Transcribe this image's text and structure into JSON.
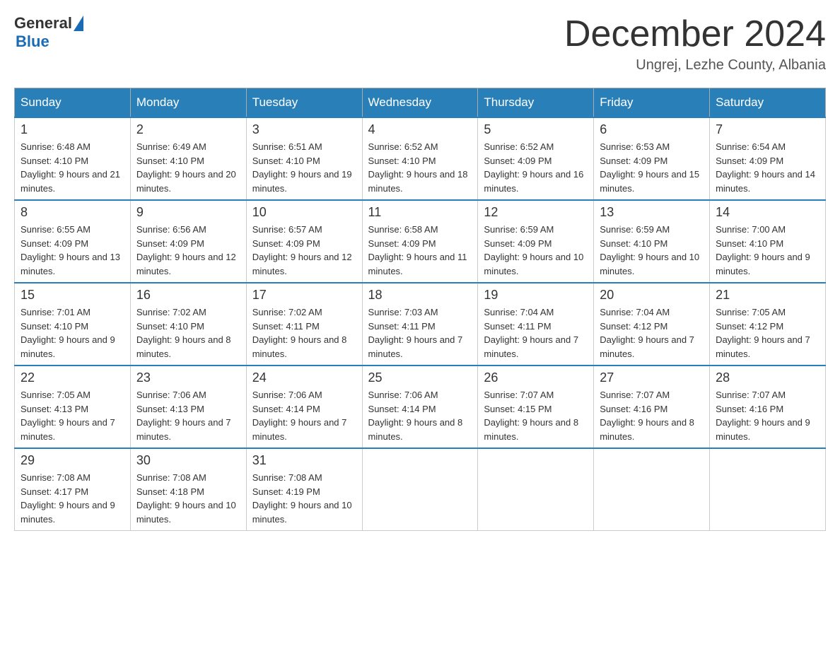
{
  "header": {
    "logo_general": "General",
    "logo_blue": "Blue",
    "month_title": "December 2024",
    "location": "Ungrej, Lezhe County, Albania"
  },
  "days_of_week": [
    "Sunday",
    "Monday",
    "Tuesday",
    "Wednesday",
    "Thursday",
    "Friday",
    "Saturday"
  ],
  "weeks": [
    [
      {
        "day": "1",
        "sunrise": "6:48 AM",
        "sunset": "4:10 PM",
        "daylight": "9 hours and 21 minutes."
      },
      {
        "day": "2",
        "sunrise": "6:49 AM",
        "sunset": "4:10 PM",
        "daylight": "9 hours and 20 minutes."
      },
      {
        "day": "3",
        "sunrise": "6:51 AM",
        "sunset": "4:10 PM",
        "daylight": "9 hours and 19 minutes."
      },
      {
        "day": "4",
        "sunrise": "6:52 AM",
        "sunset": "4:10 PM",
        "daylight": "9 hours and 18 minutes."
      },
      {
        "day": "5",
        "sunrise": "6:52 AM",
        "sunset": "4:09 PM",
        "daylight": "9 hours and 16 minutes."
      },
      {
        "day": "6",
        "sunrise": "6:53 AM",
        "sunset": "4:09 PM",
        "daylight": "9 hours and 15 minutes."
      },
      {
        "day": "7",
        "sunrise": "6:54 AM",
        "sunset": "4:09 PM",
        "daylight": "9 hours and 14 minutes."
      }
    ],
    [
      {
        "day": "8",
        "sunrise": "6:55 AM",
        "sunset": "4:09 PM",
        "daylight": "9 hours and 13 minutes."
      },
      {
        "day": "9",
        "sunrise": "6:56 AM",
        "sunset": "4:09 PM",
        "daylight": "9 hours and 12 minutes."
      },
      {
        "day": "10",
        "sunrise": "6:57 AM",
        "sunset": "4:09 PM",
        "daylight": "9 hours and 12 minutes."
      },
      {
        "day": "11",
        "sunrise": "6:58 AM",
        "sunset": "4:09 PM",
        "daylight": "9 hours and 11 minutes."
      },
      {
        "day": "12",
        "sunrise": "6:59 AM",
        "sunset": "4:09 PM",
        "daylight": "9 hours and 10 minutes."
      },
      {
        "day": "13",
        "sunrise": "6:59 AM",
        "sunset": "4:10 PM",
        "daylight": "9 hours and 10 minutes."
      },
      {
        "day": "14",
        "sunrise": "7:00 AM",
        "sunset": "4:10 PM",
        "daylight": "9 hours and 9 minutes."
      }
    ],
    [
      {
        "day": "15",
        "sunrise": "7:01 AM",
        "sunset": "4:10 PM",
        "daylight": "9 hours and 9 minutes."
      },
      {
        "day": "16",
        "sunrise": "7:02 AM",
        "sunset": "4:10 PM",
        "daylight": "9 hours and 8 minutes."
      },
      {
        "day": "17",
        "sunrise": "7:02 AM",
        "sunset": "4:11 PM",
        "daylight": "9 hours and 8 minutes."
      },
      {
        "day": "18",
        "sunrise": "7:03 AM",
        "sunset": "4:11 PM",
        "daylight": "9 hours and 7 minutes."
      },
      {
        "day": "19",
        "sunrise": "7:04 AM",
        "sunset": "4:11 PM",
        "daylight": "9 hours and 7 minutes."
      },
      {
        "day": "20",
        "sunrise": "7:04 AM",
        "sunset": "4:12 PM",
        "daylight": "9 hours and 7 minutes."
      },
      {
        "day": "21",
        "sunrise": "7:05 AM",
        "sunset": "4:12 PM",
        "daylight": "9 hours and 7 minutes."
      }
    ],
    [
      {
        "day": "22",
        "sunrise": "7:05 AM",
        "sunset": "4:13 PM",
        "daylight": "9 hours and 7 minutes."
      },
      {
        "day": "23",
        "sunrise": "7:06 AM",
        "sunset": "4:13 PM",
        "daylight": "9 hours and 7 minutes."
      },
      {
        "day": "24",
        "sunrise": "7:06 AM",
        "sunset": "4:14 PM",
        "daylight": "9 hours and 7 minutes."
      },
      {
        "day": "25",
        "sunrise": "7:06 AM",
        "sunset": "4:14 PM",
        "daylight": "9 hours and 8 minutes."
      },
      {
        "day": "26",
        "sunrise": "7:07 AM",
        "sunset": "4:15 PM",
        "daylight": "9 hours and 8 minutes."
      },
      {
        "day": "27",
        "sunrise": "7:07 AM",
        "sunset": "4:16 PM",
        "daylight": "9 hours and 8 minutes."
      },
      {
        "day": "28",
        "sunrise": "7:07 AM",
        "sunset": "4:16 PM",
        "daylight": "9 hours and 9 minutes."
      }
    ],
    [
      {
        "day": "29",
        "sunrise": "7:08 AM",
        "sunset": "4:17 PM",
        "daylight": "9 hours and 9 minutes."
      },
      {
        "day": "30",
        "sunrise": "7:08 AM",
        "sunset": "4:18 PM",
        "daylight": "9 hours and 10 minutes."
      },
      {
        "day": "31",
        "sunrise": "7:08 AM",
        "sunset": "4:19 PM",
        "daylight": "9 hours and 10 minutes."
      },
      null,
      null,
      null,
      null
    ]
  ]
}
